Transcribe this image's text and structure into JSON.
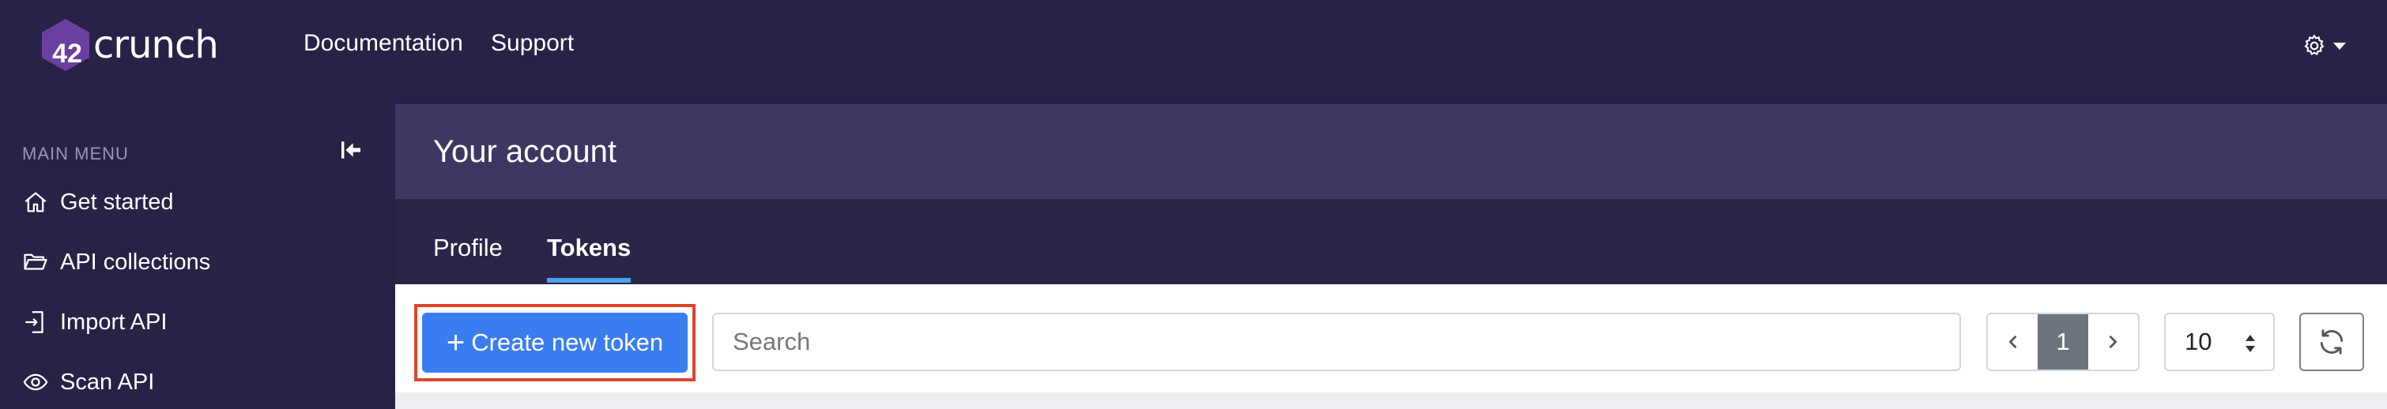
{
  "brand": {
    "logo_number": "42",
    "logo_word": "crunch"
  },
  "navbar": {
    "links": [
      "Documentation",
      "Support"
    ],
    "settings_icon": "gear-icon"
  },
  "sidebar": {
    "heading": "MAIN MENU",
    "collapse_icon": "collapse-left-icon",
    "items": [
      {
        "label": "Get started",
        "icon": "home-icon"
      },
      {
        "label": "API collections",
        "icon": "folder-open-icon"
      },
      {
        "label": "Import API",
        "icon": "import-icon"
      },
      {
        "label": "Scan API",
        "icon": "eye-icon"
      }
    ]
  },
  "page": {
    "title": "Your account"
  },
  "tabs": [
    {
      "label": "Profile",
      "active": false
    },
    {
      "label": "Tokens",
      "active": true
    }
  ],
  "toolbar": {
    "create_label": "Create new token",
    "create_plus": "+",
    "search_placeholder": "Search",
    "pagination": {
      "prev": "‹",
      "current": "1",
      "next": "›"
    },
    "per_page": "10",
    "refresh_icon": "refresh-icon"
  },
  "colors": {
    "nav_bg": "#282247",
    "header_bg": "#3e3763",
    "tabs_bg": "#2b2548",
    "accent_underline": "#4aa3f0",
    "primary_button": "#3a7df0",
    "highlight_border": "#e0442c",
    "pager_active": "#6c757d"
  }
}
